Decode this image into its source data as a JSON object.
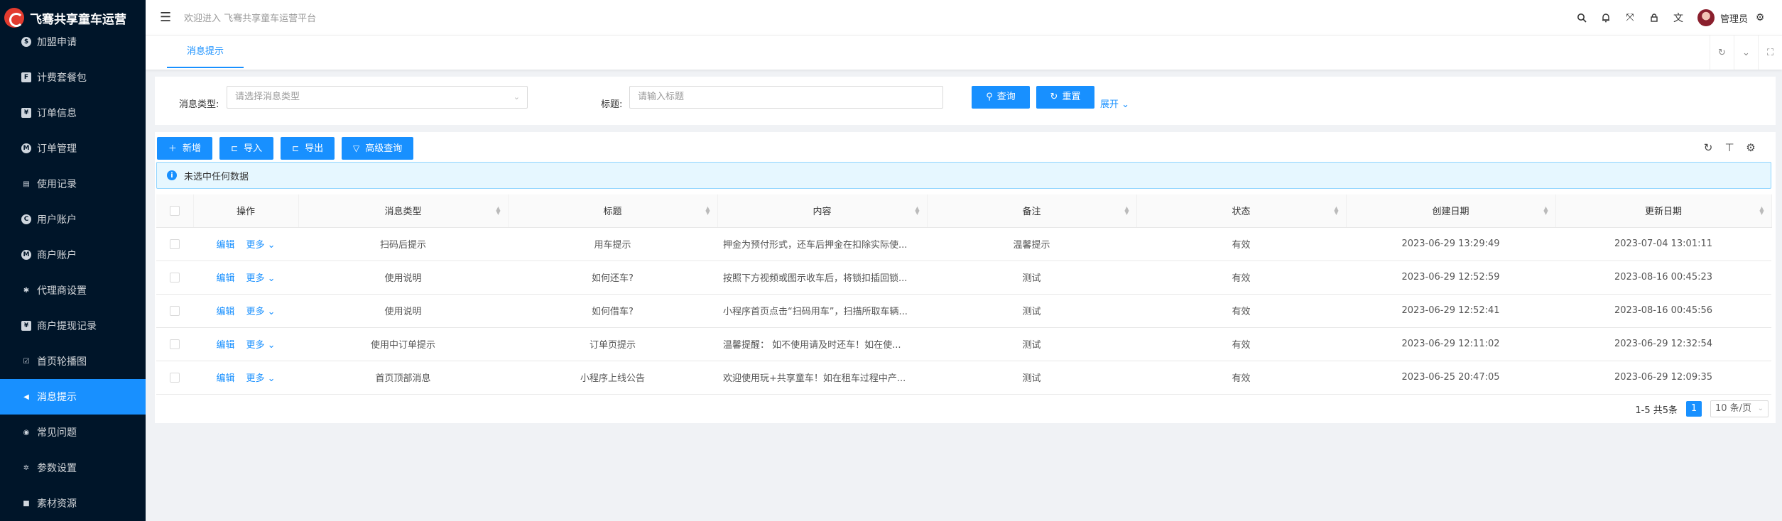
{
  "app": {
    "title": "飞骞共享童车运营",
    "welcome": "欢迎进入 飞骞共享童车运营平台",
    "username": "管理员"
  },
  "sidebar": {
    "items": [
      {
        "label": "加盟申请",
        "icon": "dollar-icon",
        "glyph": "$",
        "kind": "circ"
      },
      {
        "label": "计费套餐包",
        "icon": "package-icon",
        "glyph": "F",
        "kind": "sq"
      },
      {
        "label": "订单信息",
        "icon": "order-icon",
        "glyph": "¥",
        "kind": "sq"
      },
      {
        "label": "订单管理",
        "icon": "order-manage-icon",
        "glyph": "M",
        "kind": "circ"
      },
      {
        "label": "使用记录",
        "icon": "record-icon",
        "glyph": "▤",
        "kind": "plain"
      },
      {
        "label": "用户账户",
        "icon": "user-account-icon",
        "glyph": "C",
        "kind": "circ"
      },
      {
        "label": "商户账户",
        "icon": "merchant-account-icon",
        "glyph": "M",
        "kind": "circ"
      },
      {
        "label": "代理商设置",
        "icon": "android-icon",
        "glyph": "✱",
        "kind": "plain"
      },
      {
        "label": "商户提现记录",
        "icon": "withdraw-icon",
        "glyph": "¥",
        "kind": "sq"
      },
      {
        "label": "首页轮播图",
        "icon": "chart-icon",
        "glyph": "☑",
        "kind": "plain"
      },
      {
        "label": "消息提示",
        "icon": "notification-icon",
        "glyph": "◀",
        "kind": "plain",
        "active": true
      },
      {
        "label": "常见问题",
        "icon": "eye-icon",
        "glyph": "◉",
        "kind": "plain"
      },
      {
        "label": "参数设置",
        "icon": "settings-icon",
        "glyph": "✲",
        "kind": "plain"
      },
      {
        "label": "素材资源",
        "icon": "video-icon",
        "glyph": "■",
        "kind": "plain"
      }
    ]
  },
  "tabs": {
    "active_label": "消息提示"
  },
  "search": {
    "type_label": "消息类型:",
    "type_placeholder": "请选择消息类型",
    "title_label": "标题:",
    "title_placeholder": "请输入标题",
    "query_btn": "查询",
    "reset_btn": "重置",
    "expand": "展开"
  },
  "toolbar": {
    "add": "新增",
    "import": "导入",
    "export": "导出",
    "advanced": "高级查询"
  },
  "alert": {
    "text": "未选中任何数据"
  },
  "table": {
    "columns": [
      "操作",
      "消息类型",
      "标题",
      "内容",
      "备注",
      "状态",
      "创建日期",
      "更新日期"
    ],
    "edit_label": "编辑",
    "more_label": "更多",
    "rows": [
      {
        "type": "扫码后提示",
        "title": "用车提示",
        "content": "押金为预付形式，还车后押金在扣除实际使...",
        "remark": "温馨提示",
        "status": "有效",
        "created": "2023-06-29 13:29:49",
        "updated": "2023-07-04 13:01:11"
      },
      {
        "type": "使用说明",
        "title": "如何还车?",
        "content": "按照下方视频或图示收车后，将锁扣插回锁...",
        "remark": "测试",
        "status": "有效",
        "created": "2023-06-29 12:52:59",
        "updated": "2023-08-16 00:45:23"
      },
      {
        "type": "使用说明",
        "title": "如何借车?",
        "content": "小程序首页点击“扫码用车”，扫描所取车辆...",
        "remark": "测试",
        "status": "有效",
        "created": "2023-06-29 12:52:41",
        "updated": "2023-08-16 00:45:56"
      },
      {
        "type": "使用中订单提示",
        "title": "订单页提示",
        "content": "温馨提醒： 如不使用请及时还车！如在使...",
        "remark": "测试",
        "status": "有效",
        "created": "2023-06-29 12:11:02",
        "updated": "2023-06-29 12:32:54"
      },
      {
        "type": "首页顶部消息",
        "title": "小程序上线公告",
        "content": "欢迎使用玩+共享童车！如在租车过程中产...",
        "remark": "测试",
        "status": "有效",
        "created": "2023-06-25 20:47:05",
        "updated": "2023-06-29 12:09:35"
      }
    ]
  },
  "pagination": {
    "summary": "1-5 共5条",
    "current": "1",
    "page_size": "10 条/页"
  }
}
